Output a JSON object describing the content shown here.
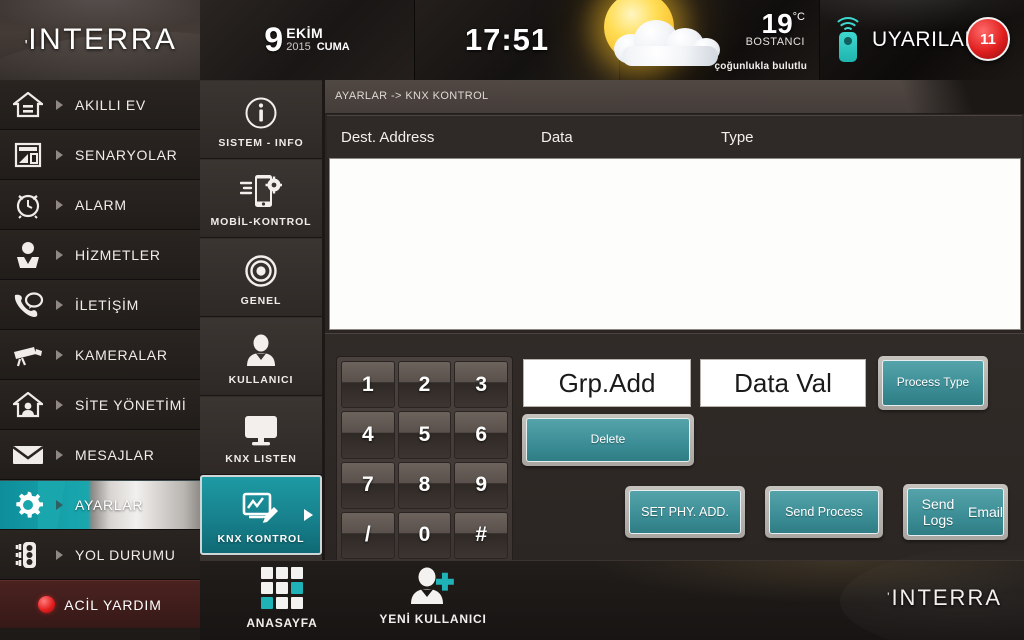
{
  "brand": {
    "logo": "INTERRA",
    "tick": "'"
  },
  "header": {
    "date": {
      "day": "9",
      "month": "EKİM",
      "year": "2015",
      "weekday": "CUMA"
    },
    "time": "17:51",
    "weather": {
      "temp": "19",
      "unit": "°C",
      "city": "BOSTANCI",
      "description": "çoğunlukla bulutlu",
      "icon": "sun-behind-cloud-icon"
    },
    "alerts": {
      "label": "UYARILAR",
      "count": "11",
      "icon": "remote-control-icon"
    }
  },
  "sidebar": {
    "items": [
      {
        "label": "AKILLI EV",
        "icon": "home-icon",
        "selected": false
      },
      {
        "label": "SENARYOLAR",
        "icon": "scenario-window-icon",
        "selected": false
      },
      {
        "label": "ALARM",
        "icon": "alarm-clock-icon",
        "selected": false
      },
      {
        "label": "HİZMETLER",
        "icon": "concierge-person-icon",
        "selected": false
      },
      {
        "label": "İLETİŞİM",
        "icon": "phone-chat-icon",
        "selected": false
      },
      {
        "label": "KAMERALAR",
        "icon": "cctv-camera-icon",
        "selected": false
      },
      {
        "label": "SİTE YÖNETİMİ",
        "icon": "home-person-icon",
        "selected": false
      },
      {
        "label": "MESAJLAR",
        "icon": "envelope-icon",
        "selected": false
      },
      {
        "label": "AYARLAR",
        "icon": "gear-icon",
        "selected": true
      },
      {
        "label": "YOL DURUMU",
        "icon": "traffic-light-icon",
        "selected": false
      }
    ],
    "emergency": {
      "label": "ACİL YARDIM",
      "icon": "red-dot-icon"
    }
  },
  "submenu": {
    "items": [
      {
        "label": "SISTEM - INFO",
        "icon": "info-circle-icon",
        "selected": false
      },
      {
        "label": "MOBİL-KONTROL",
        "icon": "mobile-gear-icon",
        "selected": false
      },
      {
        "label": "GENEL",
        "icon": "target-circles-icon",
        "selected": false
      },
      {
        "label": "KULLANICI",
        "icon": "user-icon",
        "selected": false
      },
      {
        "label": "KNX LISTEN",
        "icon": "monitor-icon",
        "selected": false
      },
      {
        "label": "KNX KONTROL",
        "icon": "monitor-pencil-icon",
        "selected": true
      }
    ]
  },
  "content": {
    "breadcrumb": "AYARLAR -> KNX KONTROL",
    "table": {
      "columns": [
        "Dest. Address",
        "Data",
        "Type"
      ],
      "rows": []
    },
    "keypad": {
      "keys": [
        "1",
        "2",
        "3",
        "4",
        "5",
        "6",
        "7",
        "8",
        "9",
        "/",
        "0",
        "#"
      ]
    },
    "fields": {
      "group_address": {
        "value": "Grp.Add"
      },
      "data_value": {
        "value": "Data Val"
      }
    },
    "buttons": {
      "process_type": "Process Type",
      "delete": "Delete",
      "set_phy_add": "SET PHY. ADD.",
      "send_process": "Send Process",
      "send_logs_email_line1": "Send Logs",
      "send_logs_email_line2": "Email"
    }
  },
  "bottombar": {
    "home": {
      "label": "ANASAYFA",
      "icon": "grid-apps-icon"
    },
    "new_user": {
      "label": "YENİ KULLANICI",
      "icon": "add-user-icon"
    },
    "logo": "INTERRA"
  },
  "colors": {
    "accent_teal": "#1aa6ad",
    "button_teal": "#3d8f97",
    "badge_red": "#e01f1f",
    "panel_dark": "#2a2522",
    "text_light": "#f2efec"
  }
}
